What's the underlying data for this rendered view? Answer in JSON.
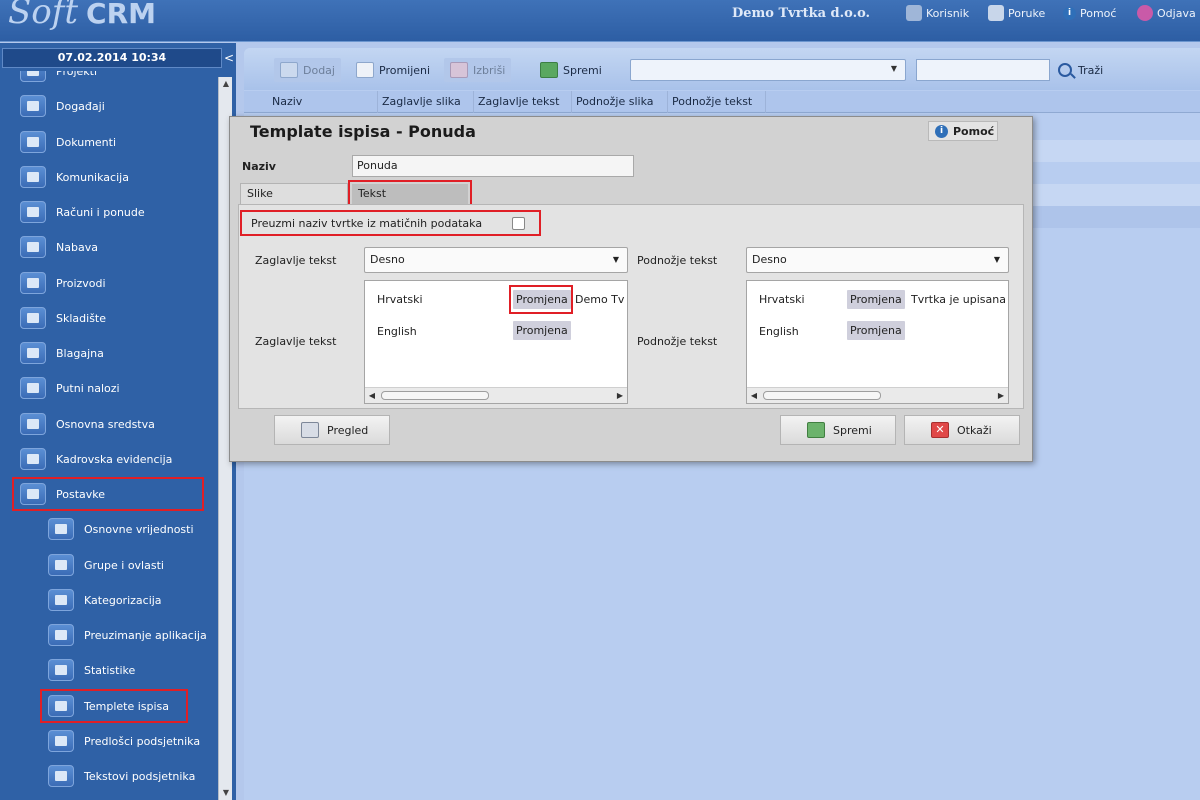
{
  "app": {
    "logo_text": "Soft",
    "logo_suffix": "CRM",
    "company": "Demo Tvrtka d.o.o.",
    "top_links": [
      "Korisnik",
      "Poruke",
      "Pomoć",
      "Odjava"
    ]
  },
  "sidebar": {
    "datetime": "07.02.2014 10:34",
    "collapse_glyph": "<",
    "items": [
      {
        "label": "Projekti",
        "icon": "projects-icon",
        "level": 0
      },
      {
        "label": "Događaji",
        "icon": "events-icon",
        "level": 0
      },
      {
        "label": "Dokumenti",
        "icon": "documents-icon",
        "level": 0
      },
      {
        "label": "Komunikacija",
        "icon": "communication-icon",
        "level": 0
      },
      {
        "label": "Računi i ponude",
        "icon": "invoices-icon",
        "level": 0
      },
      {
        "label": "Nabava",
        "icon": "procurement-icon",
        "level": 0
      },
      {
        "label": "Proizvodi",
        "icon": "products-icon",
        "level": 0
      },
      {
        "label": "Skladište",
        "icon": "warehouse-icon",
        "level": 0
      },
      {
        "label": "Blagajna",
        "icon": "cash-register-icon",
        "level": 0
      },
      {
        "label": "Putni nalozi",
        "icon": "travel-orders-icon",
        "level": 0
      },
      {
        "label": "Osnovna sredstva",
        "icon": "fixed-assets-icon",
        "level": 0
      },
      {
        "label": "Kadrovska evidencija",
        "icon": "hr-records-icon",
        "level": 0
      },
      {
        "label": "Postavke",
        "icon": "settings-tools-icon",
        "level": 0,
        "highlighted": true
      },
      {
        "label": "Osnovne vrijednosti",
        "icon": "basic-values-icon",
        "level": 1
      },
      {
        "label": "Grupe i ovlasti",
        "icon": "groups-permissions-icon",
        "level": 1
      },
      {
        "label": "Kategorizacija",
        "icon": "categorization-icon",
        "level": 1
      },
      {
        "label": "Preuzimanje aplikacija",
        "icon": "app-download-icon",
        "level": 1
      },
      {
        "label": "Statistike",
        "icon": "statistics-icon",
        "level": 1
      },
      {
        "label": "Templete ispisa",
        "icon": "print-templates-icon",
        "level": 1,
        "highlighted": true
      },
      {
        "label": "Predlošci podsjetnika",
        "icon": "reminder-templates-icon",
        "level": 1
      },
      {
        "label": "Tekstovi podsjetnika",
        "icon": "reminder-texts-icon",
        "level": 1
      }
    ]
  },
  "toolbar": {
    "add": "Dodaj",
    "edit": "Promijeni",
    "delete": "Izbriši",
    "save": "Spremi",
    "filter_value": "",
    "search_value": "",
    "search_button": "Traži"
  },
  "grid": {
    "columns": [
      "Naziv",
      "Zaglavlje slika",
      "Zaglavlje tekst",
      "Podnožje slika",
      "Podnožje tekst"
    ]
  },
  "dialog": {
    "title": "Template ispisa - Ponuda",
    "help": "Pomoć",
    "name_label": "Naziv",
    "name_value": "Ponuda",
    "tabs": [
      "Slike",
      "Tekst"
    ],
    "active_tab": "Tekst",
    "checkbox_label": "Preuzmi naziv tvrtke iz matičnih podataka",
    "checkbox_checked": false,
    "header_select_label": "Zaglavlje tekst",
    "header_select_value": "Desno",
    "footer_select_label": "Podnožje tekst",
    "footer_select_value": "Desno",
    "header_text_label": "Zaglavlje tekst",
    "footer_text_label": "Podnožje tekst",
    "header_rows": [
      {
        "lang": "Hrvatski",
        "button": "Promjena",
        "text": "Demo Tv"
      },
      {
        "lang": "English",
        "button": "Promjena",
        "text": ""
      }
    ],
    "footer_rows": [
      {
        "lang": "Hrvatski",
        "button": "Promjena",
        "text": "Tvrtka je upisana"
      },
      {
        "lang": "English",
        "button": "Promjena",
        "text": ""
      }
    ],
    "preview": "Pregled",
    "save": "Spremi",
    "cancel": "Otkaži"
  },
  "colors": {
    "header_bg": "#2d5ea4",
    "sidebar_bg": "#2f61a6",
    "main_bg": "#b8cdf0",
    "highlight": "#e01f26",
    "dialog_bg": "#d2d2d2"
  }
}
